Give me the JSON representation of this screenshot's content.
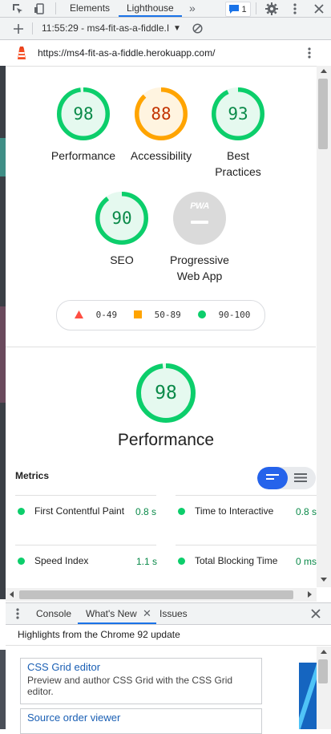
{
  "devtools": {
    "tabs": [
      {
        "label": "Elements"
      },
      {
        "label": "Lighthouse"
      }
    ],
    "issues_badge": "1"
  },
  "report_toolbar": {
    "report_label": "11:55:29 - ms4-fit-as-a-fiddle.I"
  },
  "url_bar": {
    "url": "https://ms4-fit-as-a-fiddle.herokuapp.com/"
  },
  "scores": [
    {
      "label": "Performance",
      "score": "98",
      "fraction": 0.98,
      "color": "#0cce6b",
      "text_color": "#0a8a49",
      "fill": "#e5f9ef"
    },
    {
      "label": "Accessibility",
      "score": "88",
      "fraction": 0.88,
      "color": "#ffa400",
      "text_color": "#c33300",
      "fill": "#fff4e0"
    },
    {
      "label": "Best",
      "label2": "Practices",
      "score": "93",
      "fraction": 0.93,
      "color": "#0cce6b",
      "text_color": "#0a8a49",
      "fill": "#e5f9ef"
    },
    {
      "label": "SEO",
      "score": "90",
      "fraction": 0.9,
      "color": "#0cce6b",
      "text_color": "#0a8a49",
      "fill": "#e5f9ef"
    }
  ],
  "pwa": {
    "label": "Progressive",
    "label2": "Web App",
    "badge_text": "PWA"
  },
  "legend": [
    {
      "range": "0-49",
      "color": "#ff4e42"
    },
    {
      "range": "50-89",
      "color": "#ffa400"
    },
    {
      "range": "90-100",
      "color": "#0cce6b"
    }
  ],
  "performance_section": {
    "score": "98",
    "fraction": 0.98,
    "title": "Performance"
  },
  "metrics": {
    "heading": "Metrics",
    "items": [
      {
        "name": "First Contentful Paint",
        "value": "0.8 s"
      },
      {
        "name": "Time to Interactive",
        "value": "0.8 s"
      },
      {
        "name": "Speed Index",
        "value": "1.1 s"
      },
      {
        "name": "Total Blocking Time",
        "value": "0 ms"
      }
    ]
  },
  "drawer": {
    "tabs": [
      {
        "label": "Console"
      },
      {
        "label": "What's New"
      },
      {
        "label": "Issues"
      }
    ],
    "highlights": "Highlights from the Chrome 92 update",
    "cards": [
      {
        "title": "CSS Grid editor",
        "desc": "Preview and author CSS Grid with the CSS Grid editor."
      },
      {
        "title": "Source order viewer",
        "desc": ""
      }
    ]
  },
  "colors": {
    "accent": "#1a73e8",
    "pass": "#0cce6b",
    "average": "#ffa400",
    "fail": "#ff4e42"
  }
}
